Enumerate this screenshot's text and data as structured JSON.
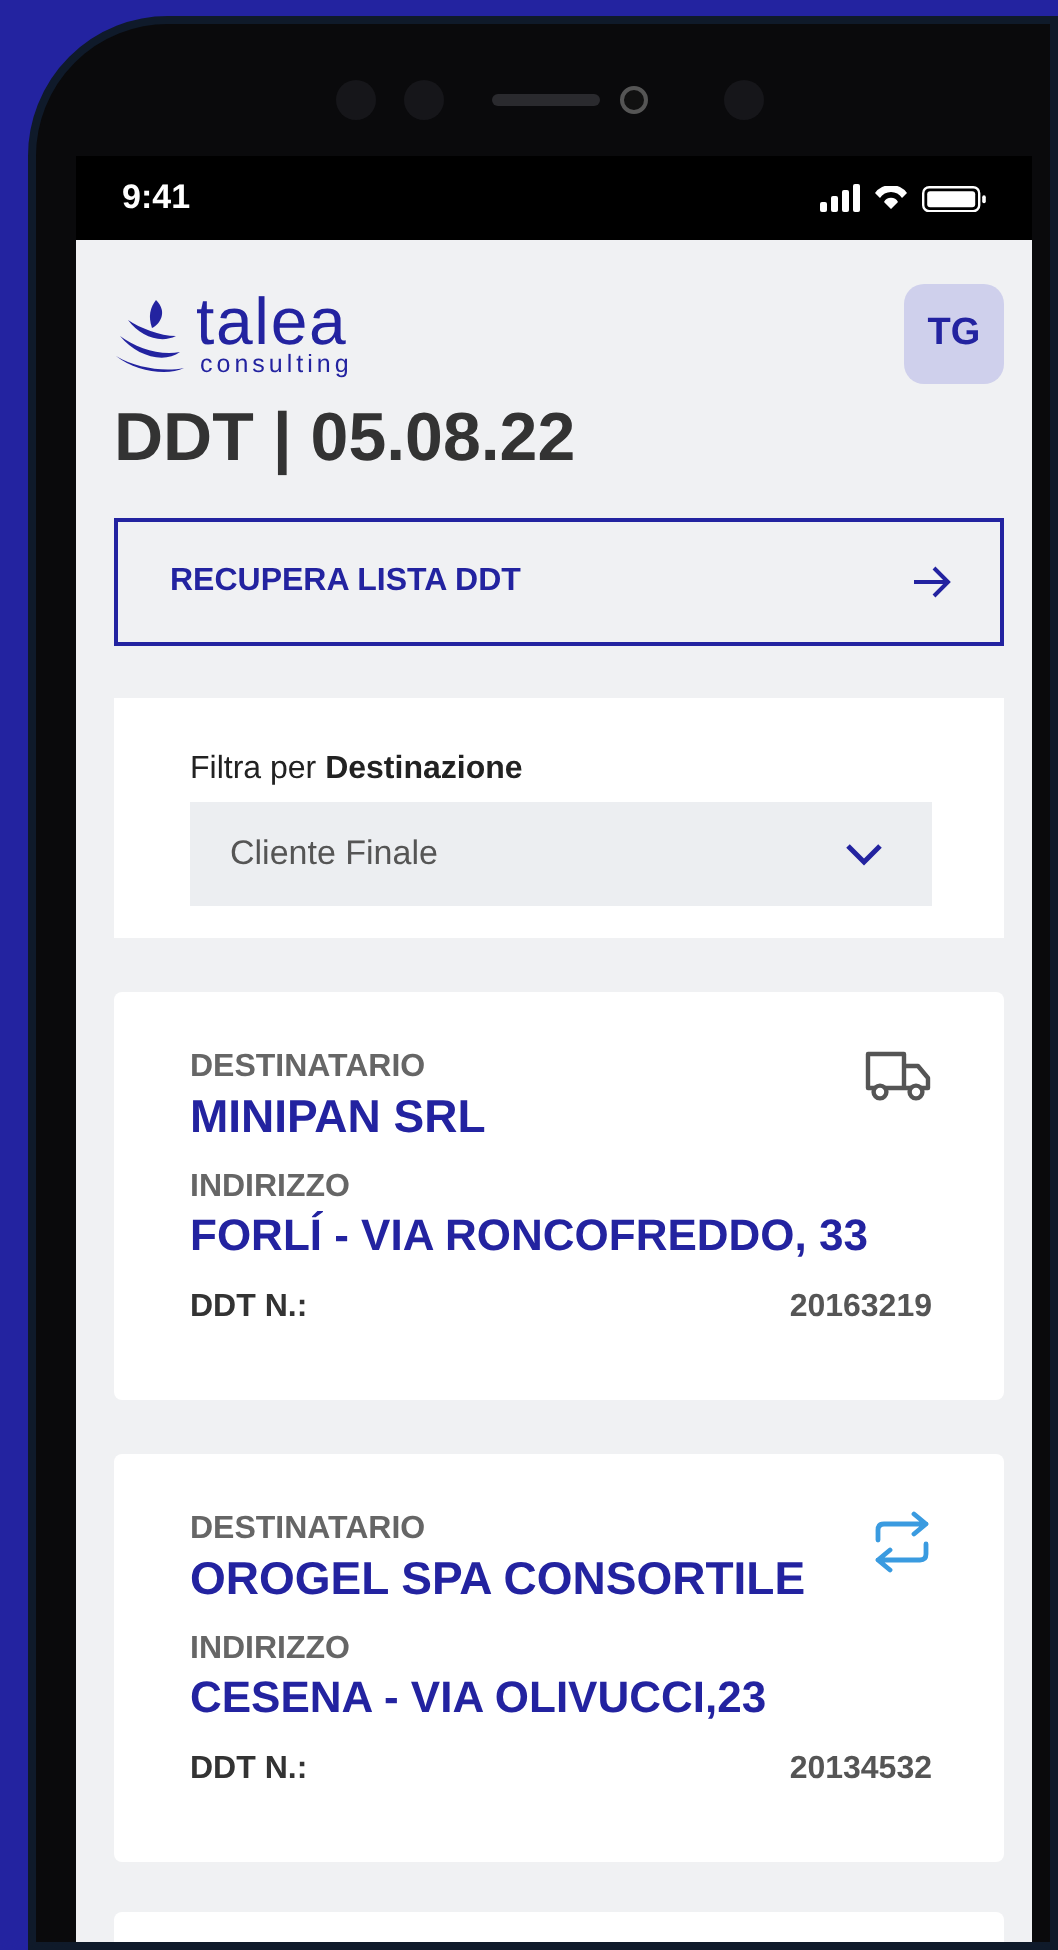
{
  "status_bar": {
    "time": "9:41"
  },
  "logo": {
    "name": "talea",
    "tagline": "consulting"
  },
  "avatar": {
    "initials": "TG"
  },
  "title": "DDT | 05.08.22",
  "action_button": {
    "label": "RECUPERA LISTA DDT"
  },
  "filter": {
    "label": "Filtra per **Destinazione**",
    "select": {
      "value": "Cliente Finale"
    }
  },
  "cards": [
    {
      "kind": "delivery",
      "recipient_label": "DESTINATARIO",
      "recipient": "MINIPAN SRL",
      "address_label": "INDIRIZZO",
      "address": "FORLÍ - VIA RONCOFREDDO, 33",
      "number_label": "DDT N.:",
      "number": "20163219"
    },
    {
      "kind": "transfer",
      "recipient_label": "DESTINATARIO",
      "recipient": "OROGEL SPA CONSORTILE",
      "address_label": "INDIRIZZO",
      "address": "CESENA - VIA OLIVUCCI,23",
      "number_label": "DDT N.:",
      "number": "20134532"
    }
  ]
}
